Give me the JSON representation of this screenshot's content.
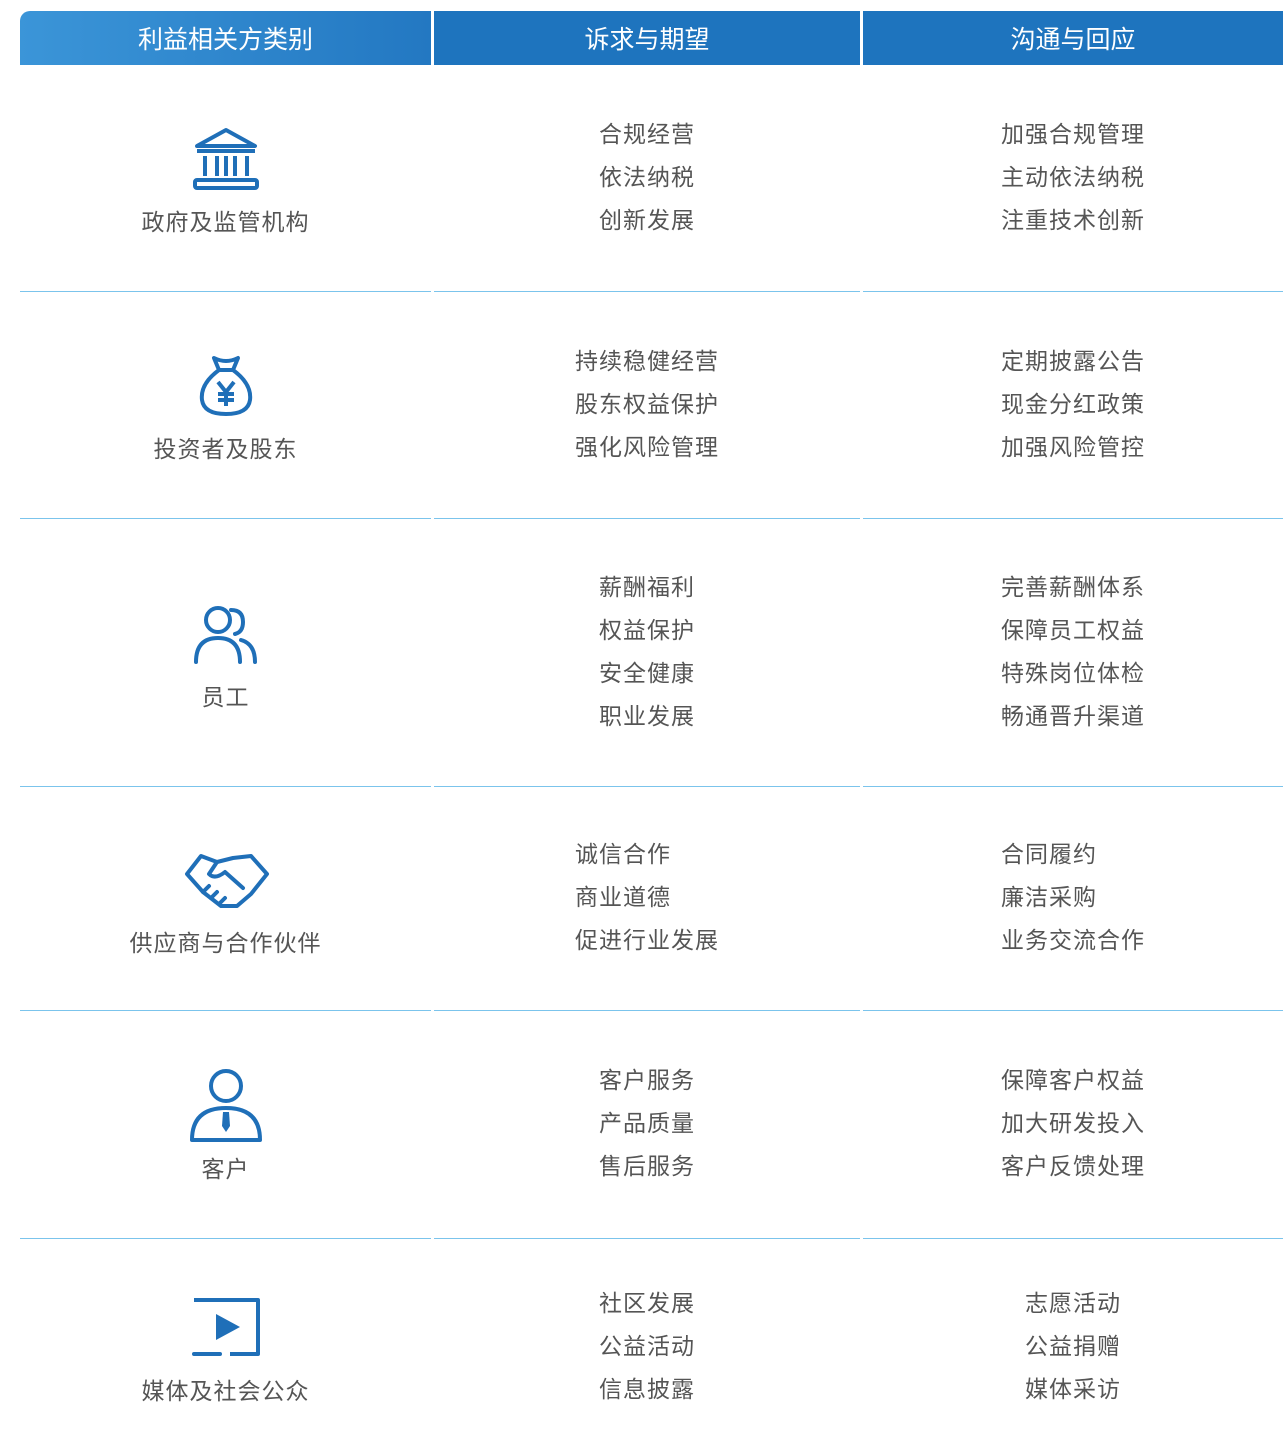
{
  "header": {
    "col1": "利益相关方类别",
    "col2": "诉求与期望",
    "col3": "沟通与回应"
  },
  "colors": {
    "header_blue": "#1e74be",
    "icon_blue": "#1f6fb8",
    "divider": "#7bc4ec",
    "text": "#555555"
  },
  "rows": [
    {
      "icon": "government-building-icon",
      "category": "政府及监管机构",
      "expectations": [
        "合规经营",
        "依法纳税",
        "创新发展"
      ],
      "responses": [
        "加强合规管理",
        "主动依法纳税",
        "注重技术创新"
      ]
    },
    {
      "icon": "money-bag-yen-icon",
      "category": "投资者及股东",
      "expectations": [
        "持续稳健经营",
        "股东权益保护",
        "强化风险管理"
      ],
      "responses": [
        "定期披露公告",
        "现金分红政策",
        "加强风险管控"
      ]
    },
    {
      "icon": "employees-icon",
      "category": "员工",
      "expectations": [
        "薪酬福利",
        "权益保护",
        "安全健康",
        "职业发展"
      ],
      "responses": [
        "完善薪酬体系",
        "保障员工权益",
        "特殊岗位体检",
        "畅通晋升渠道"
      ]
    },
    {
      "icon": "handshake-icon",
      "category": "供应商与合作伙伴",
      "expectations": [
        "诚信合作",
        "商业道德",
        "促进行业发展"
      ],
      "responses": [
        "合同履约",
        "廉洁采购",
        "业务交流合作"
      ]
    },
    {
      "icon": "customer-person-tie-icon",
      "category": "客户",
      "expectations": [
        "客户服务",
        "产品质量",
        "售后服务"
      ],
      "responses": [
        "保障客户权益",
        "加大研发投入",
        "客户反馈处理"
      ]
    },
    {
      "icon": "media-play-icon",
      "category": "媒体及社会公众",
      "expectations": [
        "社区发展",
        "公益活动",
        "信息披露"
      ],
      "responses": [
        "志愿活动",
        "公益捐赠",
        "媒体采访"
      ]
    }
  ]
}
